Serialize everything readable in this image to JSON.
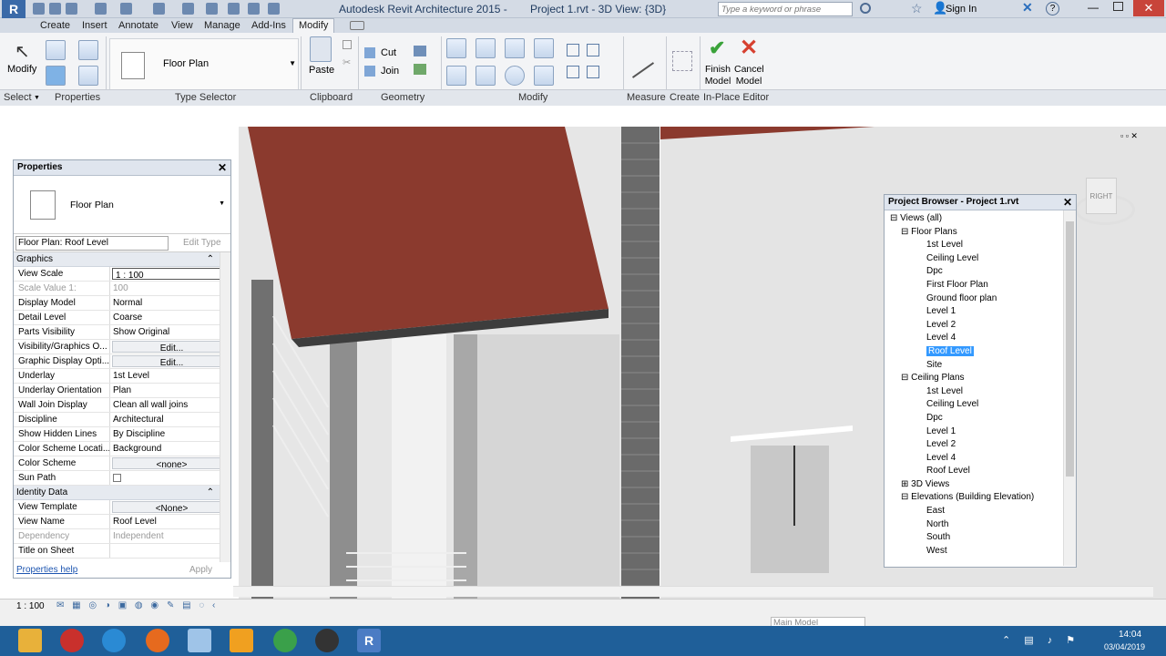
{
  "titlebar": {
    "app_title": "Autodesk Revit Architecture 2015 -",
    "doc_title": "Project 1.rvt - 3D View: {3D}",
    "search_placeholder": "Type a keyword or phrase",
    "sign_in": "Sign In"
  },
  "tabs": [
    "Create",
    "Insert",
    "Annotate",
    "View",
    "Manage",
    "Add-Ins",
    "Modify"
  ],
  "ribbon": {
    "modify_label": "Modify",
    "type_selector_value": "Floor Plan",
    "paste_label": "Paste",
    "cut_label": "Cut",
    "join_label": "Join",
    "finish_label": "Finish Model",
    "cancel_label": "Cancel Model",
    "finish_line1": "Finish",
    "finish_line2": "Model",
    "cancel_line1": "Cancel",
    "cancel_line2": "Model",
    "panels": {
      "select": "Select",
      "properties": "Properties",
      "type_selector": "Type Selector",
      "clipboard": "Clipboard",
      "geometry": "Geometry",
      "modify": "Modify",
      "measure": "Measure",
      "create": "Create",
      "inplace": "In-Place Editor"
    }
  },
  "properties": {
    "title": "Properties",
    "type_name": "Floor Plan",
    "instance_selector": "Floor Plan: Roof Level",
    "edit_type": "Edit Type",
    "groups": {
      "graphics": "Graphics",
      "identity": "Identity Data"
    },
    "graphics_rows": [
      {
        "k": "View Scale",
        "v": "1 : 100"
      },
      {
        "k": "Scale Value    1:",
        "v": "100"
      },
      {
        "k": "Display Model",
        "v": "Normal"
      },
      {
        "k": "Detail Level",
        "v": "Coarse"
      },
      {
        "k": "Parts Visibility",
        "v": "Show Original"
      },
      {
        "k": "Visibility/Graphics O...",
        "v": "Edit..."
      },
      {
        "k": "Graphic Display Opti...",
        "v": "Edit..."
      },
      {
        "k": "Underlay",
        "v": "1st Level"
      },
      {
        "k": "Underlay Orientation",
        "v": "Plan"
      },
      {
        "k": "Wall Join Display",
        "v": "Clean all wall joins"
      },
      {
        "k": "Discipline",
        "v": "Architectural"
      },
      {
        "k": "Show Hidden Lines",
        "v": "By Discipline"
      },
      {
        "k": "Color Scheme Locati...",
        "v": "Background"
      },
      {
        "k": "Color Scheme",
        "v": "<none>"
      },
      {
        "k": "Sun Path",
        "v": ""
      }
    ],
    "identity_rows": [
      {
        "k": "View Template",
        "v": "<None>"
      },
      {
        "k": "View Name",
        "v": "Roof Level"
      },
      {
        "k": "Dependency",
        "v": "Independent"
      },
      {
        "k": "Title on Sheet",
        "v": ""
      }
    ],
    "help_link": "Properties help",
    "apply": "Apply"
  },
  "browser": {
    "title": "Project Browser - Project 1.rvt",
    "root": "Views (all)",
    "floor_plans_label": "Floor Plans",
    "floor_plans": [
      "1st Level",
      "Ceiling Level",
      "Dpc",
      "First Floor Plan",
      "Ground floor plan",
      "Level 1",
      "Level 2",
      "Level 4",
      "Roof Level",
      "Site"
    ],
    "selected": "Roof Level",
    "ceiling_plans_label": "Ceiling Plans",
    "ceiling_plans": [
      "1st Level",
      "Ceiling Level",
      "Dpc",
      "Level 1",
      "Level 2",
      "Level 4",
      "Roof Level"
    ],
    "views3d_label": "3D Views",
    "elevations_label": "Elevations (Building Elevation)",
    "elevations": [
      "East",
      "North",
      "South",
      "West"
    ]
  },
  "viewcube_label": "RIGHT",
  "status": {
    "scale": "1 : 100",
    "model": "Main Model"
  },
  "taskbar": {
    "time": "14:04",
    "date": "03/04/2019"
  },
  "colors": {
    "roof": "#8b3a2e",
    "brick": "#5b5b5b",
    "ribbon_bg": "#f3f4f6",
    "taskbar": "#1f5f99",
    "selection": "#3399ff"
  }
}
